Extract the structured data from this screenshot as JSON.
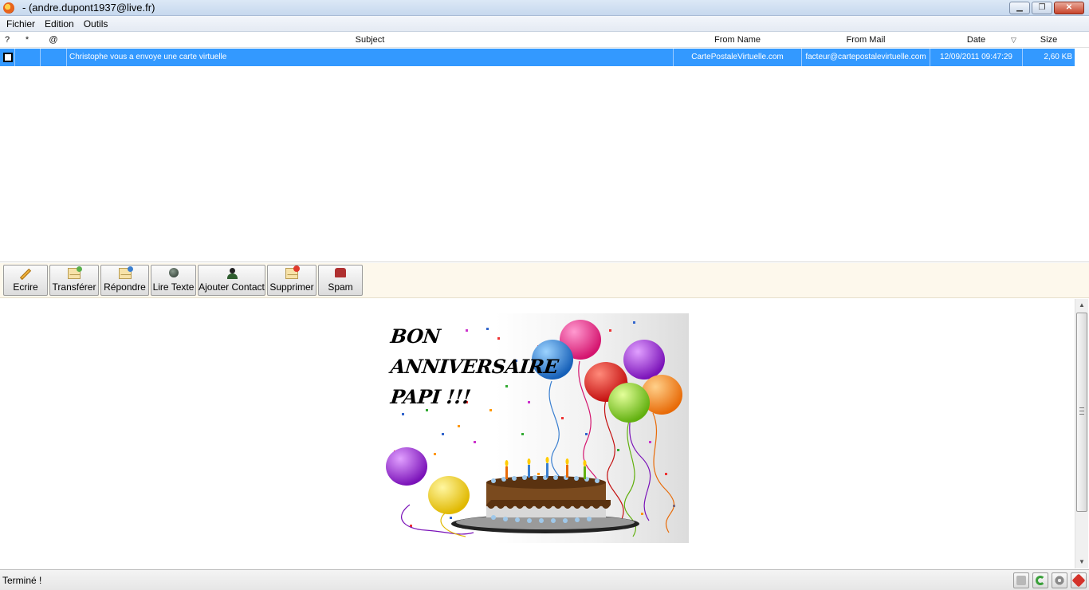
{
  "window": {
    "title": "- (andre.dupont1937@live.fr)",
    "buttons": {
      "minimize": "▁",
      "restore": "❐",
      "close": "✕"
    }
  },
  "menu": [
    "Fichier",
    "Edition",
    "Outils"
  ],
  "list": {
    "columns": [
      "?",
      "*",
      "@",
      "Subject",
      "From Name",
      "From Mail",
      "Date",
      "Size"
    ],
    "sort_glyph": "▽",
    "rows": [
      {
        "subject": "Christophe vous a envoye une carte virtuelle",
        "from_name": "CartePostaleVirtuelle.com",
        "from_mail": "facteur@cartepostalevirtuelle.com",
        "date": "12/09/2011 09:47:29",
        "size": "2,60 KB"
      }
    ]
  },
  "toolbar": {
    "buttons": [
      "Ecrire",
      "Transférer",
      "Répondre",
      "Lire Texte",
      "Ajouter Contact",
      "Supprimer",
      "Spam"
    ]
  },
  "card": {
    "lines": [
      "BON",
      "ANNIVERSAIRE",
      "PAPI !!!"
    ]
  },
  "scrollbar": {
    "up": "▲",
    "down": "▼"
  },
  "status": {
    "text": "Terminé !"
  }
}
